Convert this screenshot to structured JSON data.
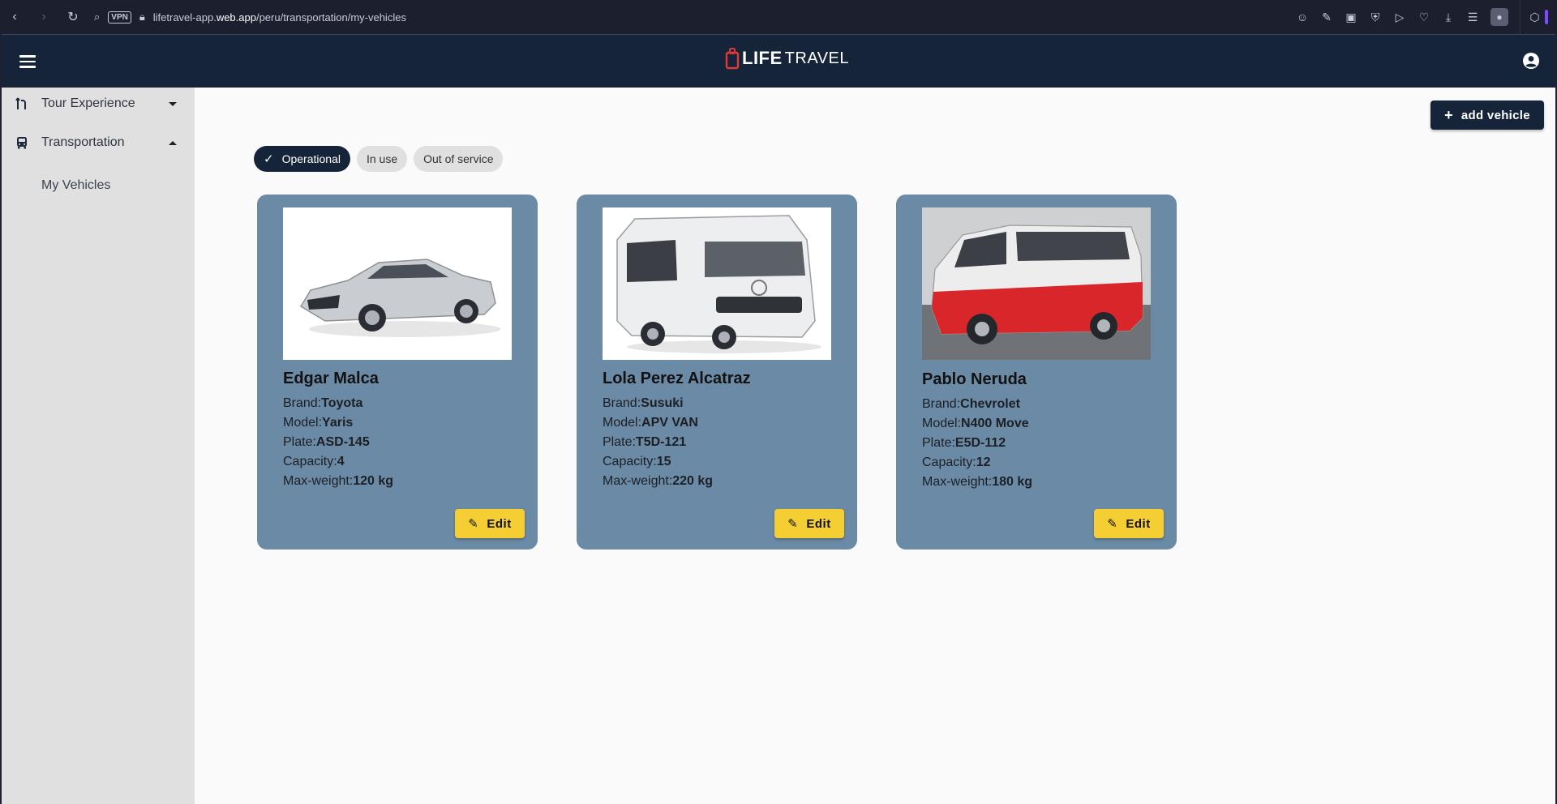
{
  "browser": {
    "url_host_prefix": "lifetravel-app.",
    "url_host_main": "web.app",
    "url_path": "/peru/transportation/my-vehicles",
    "vpn_label": "VPN"
  },
  "header": {
    "logo_part1": "LIFE",
    "logo_part2": "TRAVEL"
  },
  "sidebar": {
    "items": [
      {
        "label": "Tour Experience",
        "icon": "route-icon"
      },
      {
        "label": "Transportation",
        "icon": "bus-icon"
      }
    ],
    "sub_items": [
      {
        "label": "My Vehicles"
      }
    ]
  },
  "toolbar": {
    "add_label": "add vehicle"
  },
  "filters": [
    {
      "label": "Operational",
      "selected": true
    },
    {
      "label": "In use",
      "selected": false
    },
    {
      "label": "Out of service",
      "selected": false
    }
  ],
  "labels": {
    "brand": "Brand:",
    "model": "Model:",
    "plate": "Plate:",
    "capacity": "Capacity:",
    "max_weight": "Max-weight:",
    "edit": "Edit"
  },
  "vehicles": [
    {
      "driver": "Edgar Malca",
      "brand": "Toyota",
      "model": "Yaris",
      "plate": "ASD-145",
      "capacity": "4",
      "max_weight": "120 kg",
      "image": "silver-sedan"
    },
    {
      "driver": "Lola Perez Alcatraz",
      "brand": "Susuki",
      "model": "APV VAN",
      "plate": "T5D-121",
      "capacity": "15",
      "max_weight": "220 kg",
      "image": "white-van"
    },
    {
      "driver": "Pablo Neruda",
      "brand": "Chevrolet",
      "model": "N400 Move",
      "plate": "E5D-112",
      "capacity": "12",
      "max_weight": "180 kg",
      "image": "red-minivan"
    }
  ],
  "colors": {
    "primary": "#152438",
    "card": "#6b8aa5",
    "edit_button": "#f4ce32",
    "sidebar": "#e0e0e0"
  }
}
